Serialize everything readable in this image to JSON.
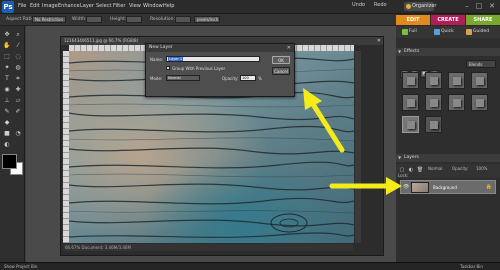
{
  "app": {
    "logo_text": "Ps",
    "menu": [
      "File",
      "Edit",
      "Image",
      "Enhance",
      "Layer",
      "Select",
      "Filter",
      "View",
      "Window",
      "Help"
    ],
    "undo": "Undo",
    "redo": "Redo",
    "organizer": "Organizer",
    "window_controls": [
      "–",
      "□",
      "✕"
    ]
  },
  "options_bar": {
    "aspect_label": "Aspect Ratio:",
    "aspect_value": "No Restriction",
    "width_label": "Width:",
    "height_label": "Height:",
    "resolution_label": "Resolution:",
    "resolution_unit": "pixels/inch"
  },
  "mode_tabs": [
    {
      "label": "EDIT",
      "color": "#e08a1e"
    },
    {
      "label": "CREATE",
      "color": "#b01e5a"
    },
    {
      "label": "SHARE",
      "color": "#7aa82e"
    }
  ],
  "edit_tabs": [
    "Full",
    "Quick",
    "Guided"
  ],
  "document": {
    "title": "121643406511.jpg @ 66.7% (RGB/8)",
    "status": "66.67%   Document: 3.46M/3.46M"
  },
  "dialog": {
    "title": "New Layer",
    "name_label": "Name:",
    "name_value": "Layer 1",
    "group_label": "Group With Previous Layer",
    "mode_label": "Mode:",
    "mode_value": "Normal",
    "opacity_label": "Opacity:",
    "opacity_value": "100",
    "opacity_unit": "%",
    "ok": "OK",
    "cancel": "Cancel"
  },
  "effects": {
    "header": "Effects",
    "filter_select": "Blends"
  },
  "layers": {
    "header": "Layers",
    "mode": "Normal",
    "opacity_label": "Opacity:",
    "opacity_value": "100%",
    "lock_label": "Lock:",
    "items": [
      {
        "name": "Background",
        "visible": true,
        "locked": true
      }
    ]
  },
  "statusbar": {
    "left": "Show Project Bin",
    "right": "Taskbar Bin"
  },
  "colors": {
    "arrow": "#f5ea1a"
  }
}
